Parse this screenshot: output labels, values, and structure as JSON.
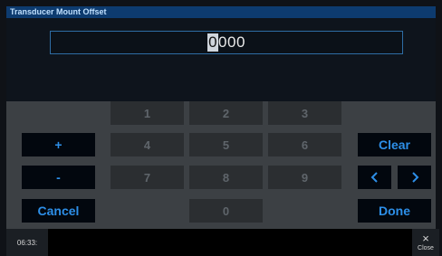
{
  "window": {
    "title": "Transducer Mount Offset"
  },
  "input": {
    "cursor_char": "0",
    "rest_value": "000"
  },
  "keypad": {
    "digits": [
      "1",
      "2",
      "3",
      "4",
      "5",
      "6",
      "7",
      "8",
      "9",
      "0"
    ],
    "plus_label": "+",
    "minus_label": "-",
    "cancel_label": "Cancel",
    "clear_label": "Clear",
    "done_label": "Done",
    "left_icon": "chevron-left-icon",
    "right_icon": "chevron-right-icon"
  },
  "status": {
    "time": "06:33:",
    "close_label": "Close",
    "close_glyph": "×"
  },
  "colors": {
    "title_bar": "#0d3b6f",
    "accent": "#2d8fe8",
    "keypad_bg": "#3c4044",
    "key_bg": "#2b2e31",
    "button_bg": "#02070e",
    "input_border": "#2e6da4"
  }
}
